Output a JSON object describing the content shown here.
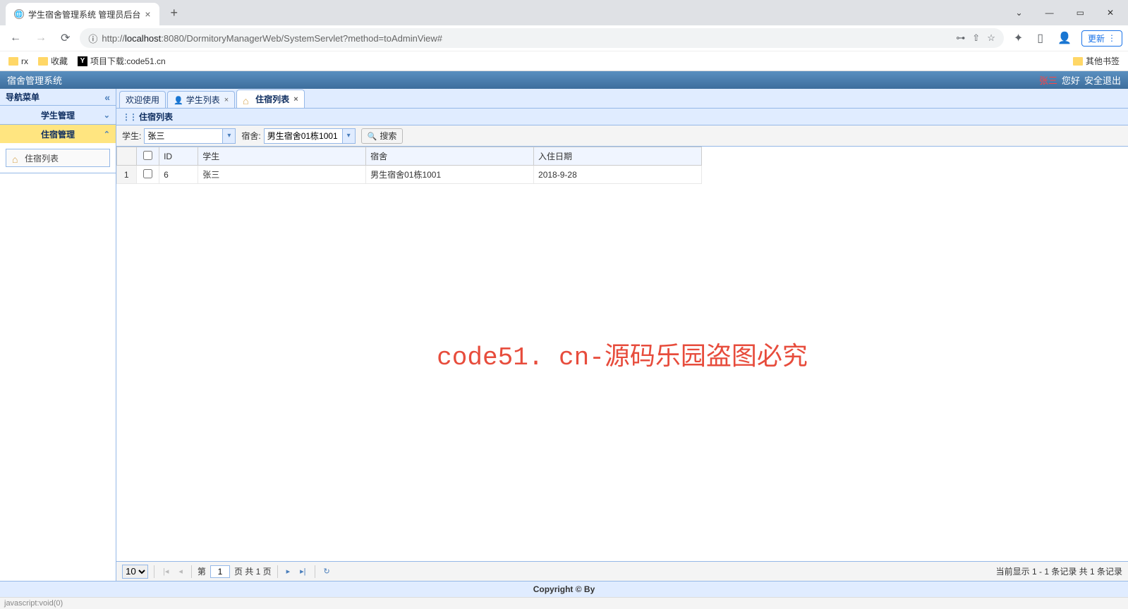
{
  "browser": {
    "tab_title": "学生宿舍管理系统 管理员后台",
    "url_prefix": "http://",
    "url_host": "localhost",
    "url_path": ":8080/DormitoryManagerWeb/SystemServlet?method=toAdminView#",
    "update_btn": "更新",
    "bookmarks": {
      "rx": "rx",
      "fav": "收藏",
      "download": "项目下载:code51.cn",
      "other": "其他书签"
    }
  },
  "header": {
    "title": "宿舍管理系统",
    "user": "张三",
    "greeting": "您好",
    "logout": "安全退出"
  },
  "sidebar": {
    "title": "导航菜单",
    "groups": {
      "student": "学生管理",
      "accommodation": "住宿管理"
    },
    "accommodation_list": "住宿列表"
  },
  "tabs": {
    "welcome": "欢迎使用",
    "student_list": "学生列表",
    "accommodation_list": "住宿列表"
  },
  "panel": {
    "title": "住宿列表"
  },
  "filter": {
    "student_label": "学生:",
    "student_value": "张三",
    "dorm_label": "宿舍:",
    "dorm_value": "男生宿舍01栋1001",
    "search": "搜索"
  },
  "table": {
    "headers": {
      "id": "ID",
      "student": "学生",
      "dorm": "宿舍",
      "date": "入住日期"
    },
    "rows": [
      {
        "num": "1",
        "id": "6",
        "student": "张三",
        "dorm": "男生宿舍01栋1001",
        "date": "2018-9-28"
      }
    ]
  },
  "watermark": "code51. cn-源码乐园盗图必究",
  "pagination": {
    "page_size": "10",
    "before_input": "第",
    "current": "1",
    "after_input": "页 共 1 页",
    "info": "当前显示 1 - 1 条记录 共 1 条记录"
  },
  "footer": "Copyright © By",
  "status_bar": "javascript:void(0)"
}
